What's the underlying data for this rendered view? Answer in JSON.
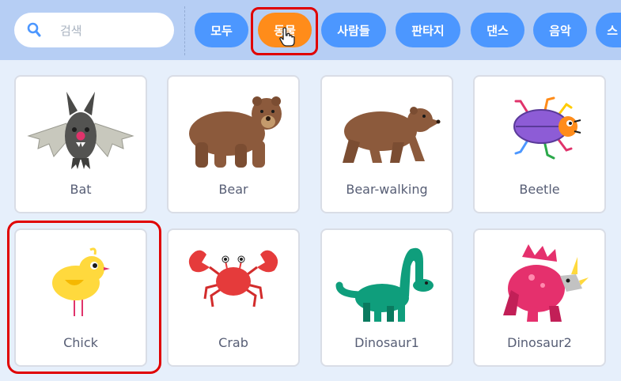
{
  "search": {
    "placeholder": "검색",
    "icon": "search-icon"
  },
  "categories": [
    {
      "label": "모두",
      "active": false
    },
    {
      "label": "동물",
      "active": true
    },
    {
      "label": "사람들",
      "active": false
    },
    {
      "label": "판타지",
      "active": false
    },
    {
      "label": "댄스",
      "active": false
    },
    {
      "label": "음악",
      "active": false
    },
    {
      "label": "스",
      "active": false
    }
  ],
  "sprites": [
    {
      "name": "Bat"
    },
    {
      "name": "Bear"
    },
    {
      "name": "Bear-walking"
    },
    {
      "name": "Beetle"
    },
    {
      "name": "Chick"
    },
    {
      "name": "Crab"
    },
    {
      "name": "Dinosaur1"
    },
    {
      "name": "Dinosaur2"
    }
  ],
  "colors": {
    "topbar": "#b6cef4",
    "category_button": "#4c97ff",
    "category_active": "#ff8c1a",
    "highlight": "#e00000",
    "sprite_label": "#575e75"
  }
}
